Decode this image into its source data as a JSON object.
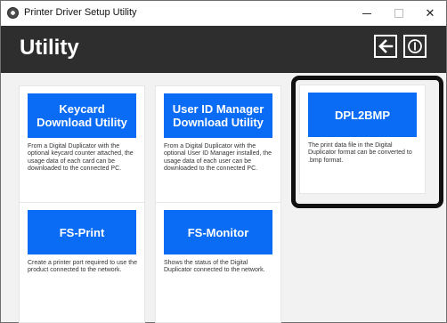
{
  "window": {
    "title": "Printer Driver Setup Utility",
    "min_icon": "minimize-icon",
    "max_icon": "maximize-icon",
    "close_glyph": "✕"
  },
  "header": {
    "title": "Utility",
    "back_icon": "back-arrow-icon",
    "power_icon": "power-icon"
  },
  "colors": {
    "header_bg": "#2e2e2e",
    "tile_blue": "#0a6cf5",
    "content_bg": "#f2f2f2",
    "highlight_border": "#111111"
  },
  "cards": [
    {
      "title_lines": [
        "Keycard",
        "Download Utility"
      ],
      "description": "From a Digital Duplicator with the optional keycard counter attached, the usage data of each card can be downloaded to the connected PC."
    },
    {
      "title_lines": [
        "User ID Manager",
        "Download Utility"
      ],
      "description": "From a Digital Duplicator with the optional User ID Manager installed, the usage data of each user can be downloaded to the connected PC."
    },
    {
      "title_lines": [
        "DPL2BMP"
      ],
      "description": "The print data file in the Digital Duplicator format can be converted to .bmp format."
    },
    {
      "title_lines": [
        "FS-Print"
      ],
      "description": "Create a printer port required to use the product connected to the network."
    },
    {
      "title_lines": [
        "FS-Monitor"
      ],
      "description": "Shows the status of the Digital Duplicator connected to the network."
    }
  ]
}
